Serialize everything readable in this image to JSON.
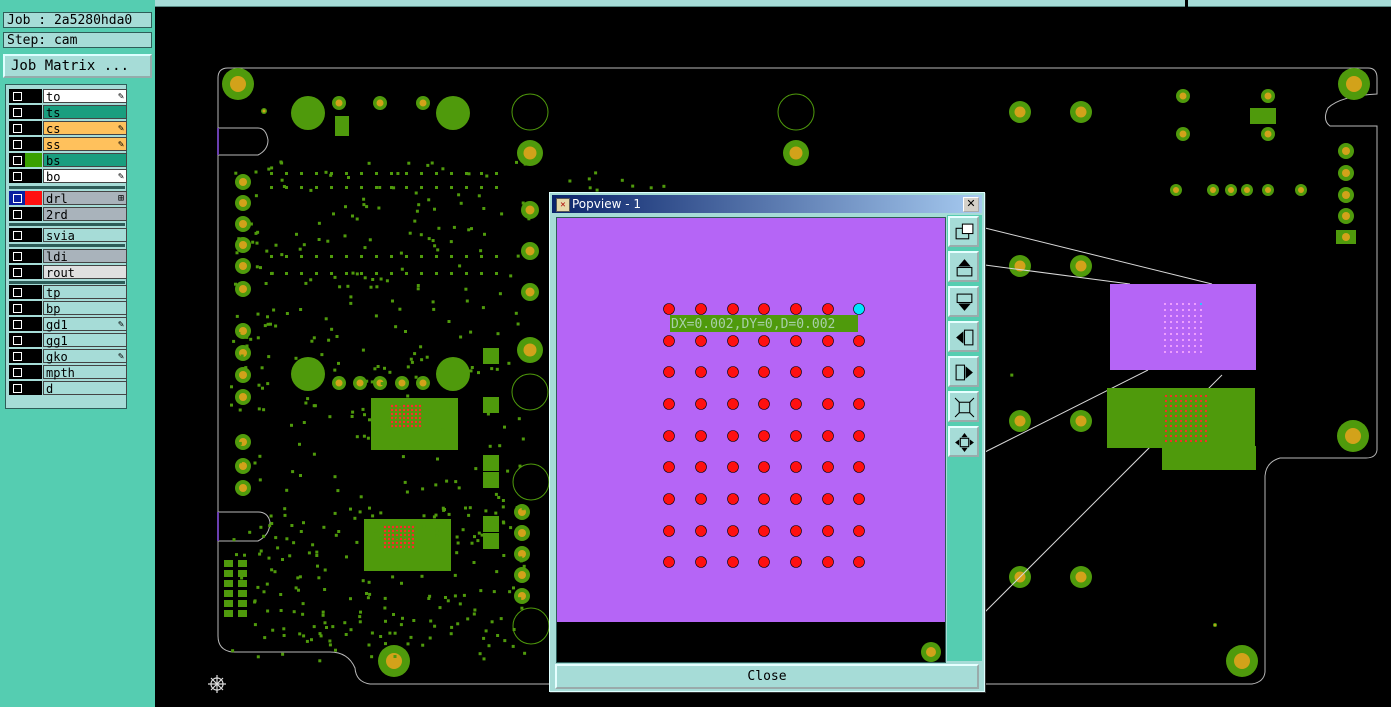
{
  "job": {
    "job_label": "Job : 2a5280hda0",
    "step_label": "Step: cam"
  },
  "job_matrix_label": "Job Matrix ...",
  "layers": [
    {
      "name": "to",
      "color": "#ffffff",
      "mark": "✎",
      "sel": "#000000"
    },
    {
      "name": "ts",
      "color": "#1a9e7f",
      "mark": "",
      "sel": "#000000"
    },
    {
      "name": "cs",
      "color": "#ffc15c",
      "mark": "✎",
      "sel": "#000000"
    },
    {
      "name": "ss",
      "color": "#ffc15c",
      "mark": "✎",
      "sel": "#000000"
    },
    {
      "name": "bs",
      "color": "#1a9e7f",
      "mark": "",
      "sel": "#3aa000"
    },
    {
      "name": "bo",
      "color": "#ffffff",
      "mark": "✎",
      "sel": "#000000"
    },
    {
      "name": "drl",
      "color": "#a9b3bb",
      "mark": "⊞",
      "sel": "#ff1010",
      "chk_sel": true
    },
    {
      "name": "2rd",
      "color": "#a9b3bb",
      "mark": "",
      "sel": "#000000"
    },
    {
      "name": "svia",
      "color": "#a6dcd7",
      "mark": "",
      "sel": "#000000"
    },
    {
      "name": "ldi",
      "color": "#a9b3bb",
      "mark": "",
      "sel": "#000000"
    },
    {
      "name": "rout",
      "color": "#e0e0e0",
      "mark": "",
      "sel": "#000000"
    },
    {
      "name": "tp",
      "color": "#a6dcd7",
      "mark": "",
      "sel": "#000000"
    },
    {
      "name": "bp",
      "color": "#a6dcd7",
      "mark": "",
      "sel": "#000000"
    },
    {
      "name": "gd1",
      "color": "#a6dcd7",
      "mark": "✎",
      "sel": "#000000"
    },
    {
      "name": "gg1",
      "color": "#a6dcd7",
      "mark": "",
      "sel": "#000000"
    },
    {
      "name": "gko",
      "color": "#a6dcd7",
      "mark": "✎",
      "sel": "#000000"
    },
    {
      "name": "mpth",
      "color": "#a6dcd7",
      "mark": "",
      "sel": "#000000"
    },
    {
      "name": "d",
      "color": "#a6dcd7",
      "mark": "",
      "sel": "#000000"
    }
  ],
  "popview": {
    "title": "Popview - 1",
    "measure_text": "DX=0.002,DY=0,D=0.002",
    "close_label": "Close",
    "toolbar_icons": [
      "copy-icon",
      "move-up-icon",
      "move-down-icon",
      "move-left-icon",
      "move-right-icon",
      "zoom-fit-icon",
      "zoom-home-icon"
    ]
  },
  "colors": {
    "panel": "#55cdb1",
    "panel_light": "#a6dcd7",
    "pad_copper": "#4f9a0c",
    "pad_finish": "#d2a21a",
    "popup_bg": "#b565f6",
    "drill_red": "#ff1010",
    "drill_selected": "#00e5ff"
  }
}
